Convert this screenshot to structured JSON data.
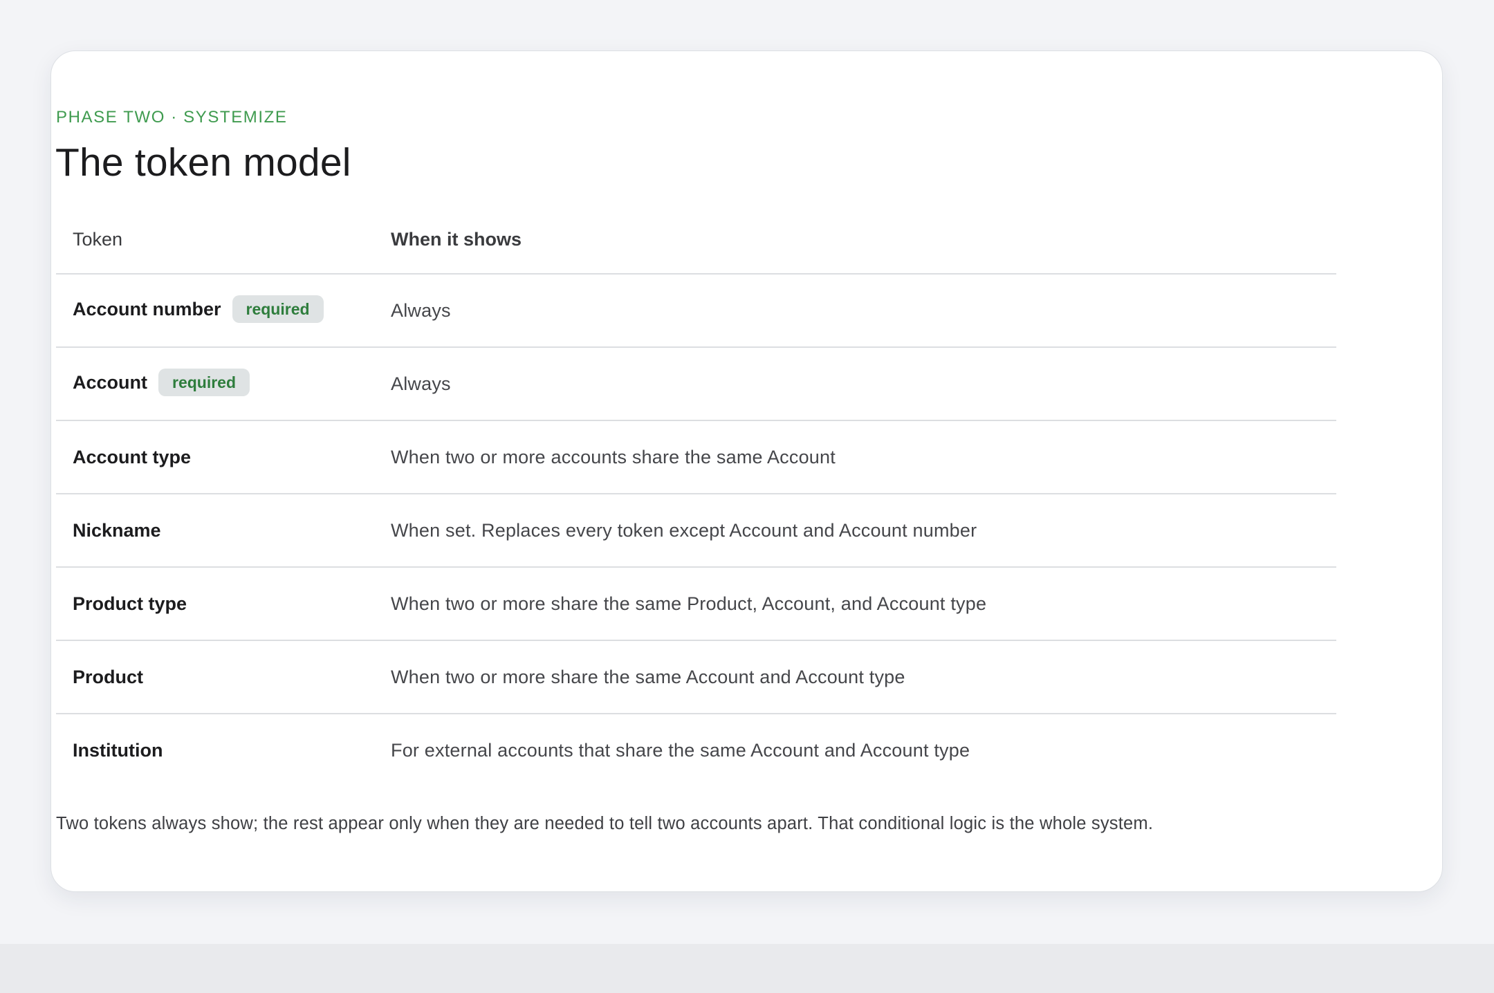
{
  "eyebrow": "PHASE TWO · SYSTEMIZE",
  "title": "The token model",
  "table": {
    "headers": {
      "token": "Token",
      "when": "When it shows"
    },
    "rows": [
      {
        "token": "Account number",
        "badge": "required",
        "when": "Always"
      },
      {
        "token": "Account",
        "badge": "required",
        "when": "Always"
      },
      {
        "token": "Account type",
        "badge": null,
        "when": "When two or more accounts share the same Account"
      },
      {
        "token": "Nickname",
        "badge": null,
        "when": "When set. Replaces every token except Account and Account number"
      },
      {
        "token": "Product type",
        "badge": null,
        "when": "When two or more share the same Product, Account, and Account type"
      },
      {
        "token": "Product",
        "badge": null,
        "when": "When two or more share the same Account and Account type"
      },
      {
        "token": "Institution",
        "badge": null,
        "when": "For external accounts that share the same Account and Account type"
      }
    ]
  },
  "footnote": "Two tokens always show; the rest appear only when they are needed to tell two accounts apart. That conditional logic is the whole system.",
  "colors": {
    "accent": "#3f9b4f",
    "badge_text": "#2e7d3c",
    "badge_bg": "#dfe3e4",
    "page_bg": "#f3f4f7",
    "card_bg": "#ffffff"
  }
}
